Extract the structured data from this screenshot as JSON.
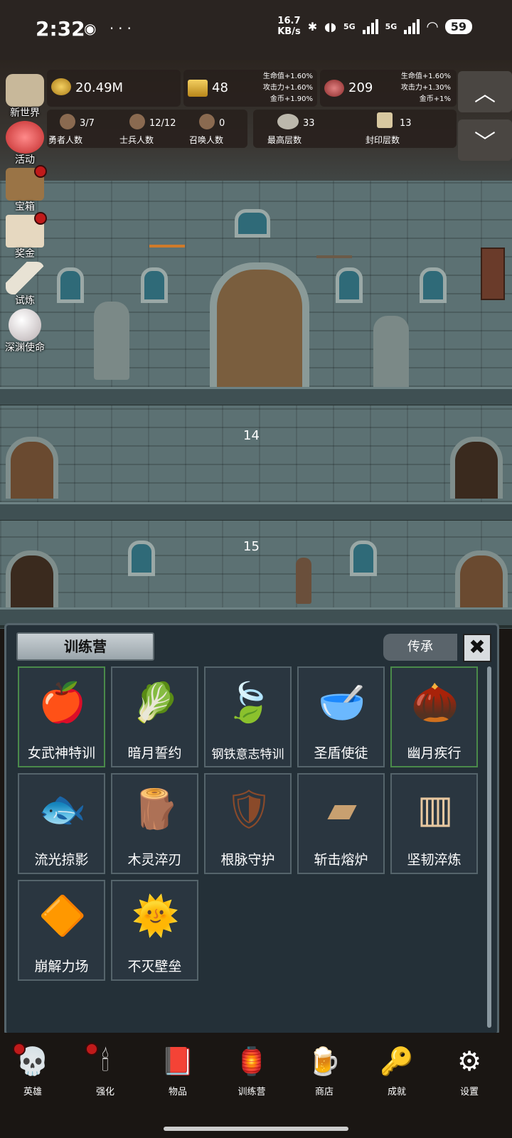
{
  "status": {
    "time": "2:32",
    "net_speed_value": "16.7",
    "net_speed_unit": "KB/s",
    "battery": "59",
    "net1": "5G",
    "net2": "5G"
  },
  "resources": {
    "gold": {
      "value": "20.49M",
      "icon": "gold-coin-icon"
    },
    "bar": {
      "value": "48",
      "bonus": [
        "生命值+1.60%",
        "攻击力+1.60%",
        "金币+1.90%"
      ],
      "icon": "gold-bar-icon"
    },
    "meat": {
      "value": "209",
      "bonus": [
        "生命值+1.60%",
        "攻击力+1.30%",
        "金币+1%"
      ],
      "icon": "meat-icon"
    }
  },
  "counts": {
    "hero": {
      "value": "3/7",
      "label": "勇者人数"
    },
    "soldier": {
      "value": "12/12",
      "label": "士兵人数"
    },
    "summon": {
      "value": "0",
      "label": "召唤人数"
    },
    "max_floor": {
      "value": "33",
      "label": "最高层数"
    },
    "seal_floor": {
      "value": "13",
      "label": "封印层数"
    }
  },
  "side_menu": [
    {
      "label": "新世界",
      "icon": "castle-icon",
      "dot": false
    },
    {
      "label": "活动",
      "icon": "heart-icon",
      "dot": false
    },
    {
      "label": "宝箱",
      "icon": "chest-icon",
      "dot": true
    },
    {
      "label": "奖金",
      "icon": "envelope-icon",
      "dot": true
    },
    {
      "label": "试炼",
      "icon": "feather-icon",
      "dot": false
    },
    {
      "label": "深渊使命",
      "icon": "pearl-icon",
      "dot": false
    }
  ],
  "floors": [
    "14",
    "15"
  ],
  "training": {
    "title": "训练营",
    "inherit_label": "传承",
    "close_label": "✖",
    "items": [
      {
        "label": "女武神特训",
        "icon": "apple-icon",
        "glyph": "🍎",
        "active": true
      },
      {
        "label": "暗月誓约",
        "icon": "cabbage-icon",
        "glyph": "🥬",
        "active": false
      },
      {
        "label": "钢铁意志特训",
        "icon": "leaf-icon",
        "glyph": "🍃",
        "active": false
      },
      {
        "label": "圣盾使徒",
        "icon": "bowl-icon",
        "glyph": "🥣",
        "active": false
      },
      {
        "label": "幽月疾行",
        "icon": "acorn-icon",
        "glyph": "🌰",
        "active": true
      },
      {
        "label": "流光掠影",
        "icon": "fish-fossil-icon",
        "glyph": "🐟",
        "active": false
      },
      {
        "label": "木灵淬刃",
        "icon": "log-icon",
        "glyph": "🪵",
        "active": false
      },
      {
        "label": "根脉守护",
        "icon": "wooden-shield-icon",
        "glyph": "🛡",
        "active": false
      },
      {
        "label": "斩击熔炉",
        "icon": "wood-block-icon",
        "glyph": "▰",
        "active": false
      },
      {
        "label": "坚韧淬炼",
        "icon": "wooden-door-icon",
        "glyph": "▥",
        "active": false
      },
      {
        "label": "崩解力场",
        "icon": "lava-orb-icon",
        "glyph": "🔶",
        "active": false
      },
      {
        "label": "不灭壁垒",
        "icon": "sun-shield-icon",
        "glyph": "🌞",
        "active": false
      }
    ]
  },
  "nav": [
    {
      "label": "英雄",
      "icon": "skull-icon",
      "glyph": "💀",
      "dot": true
    },
    {
      "label": "强化",
      "icon": "candle-icon",
      "glyph": "🕯",
      "dot": true
    },
    {
      "label": "物品",
      "icon": "book-icon",
      "glyph": "📕",
      "dot": false
    },
    {
      "label": "训练营",
      "icon": "lantern-icon",
      "glyph": "🏮",
      "dot": false
    },
    {
      "label": "商店",
      "icon": "beer-mug-icon",
      "glyph": "🍺",
      "dot": false
    },
    {
      "label": "成就",
      "icon": "key-icon",
      "glyph": "🔑",
      "dot": false
    },
    {
      "label": "设置",
      "icon": "gear-icon",
      "glyph": "⚙",
      "dot": false
    }
  ]
}
